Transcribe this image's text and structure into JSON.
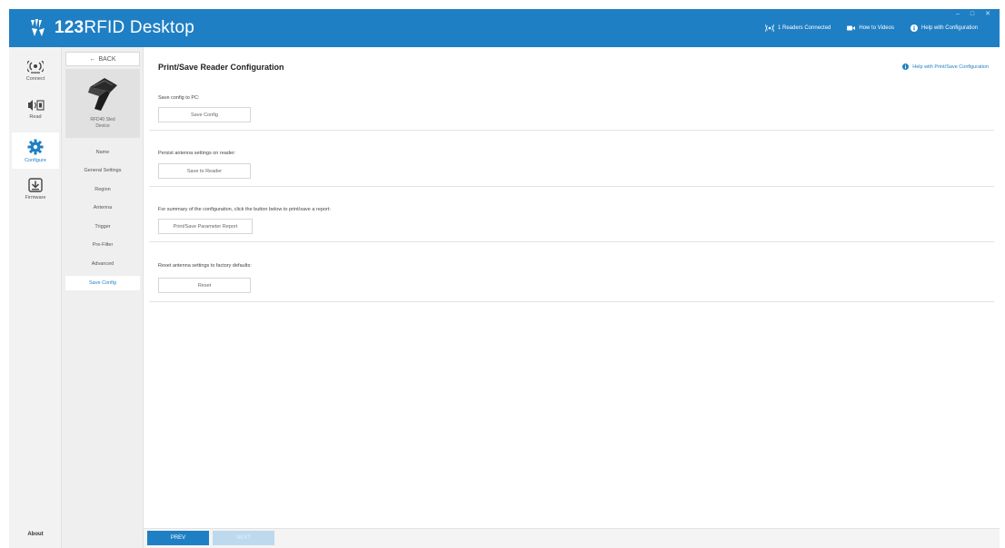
{
  "app": {
    "title_prefix": "123",
    "title_suffix": "RFID Desktop"
  },
  "titlebar": {
    "readers_connected": "1 Readers Connected",
    "how_to_videos": "How to Videos",
    "help_with_configuration": "Help with Configuration",
    "window_controls": [
      "–",
      "□",
      "✕"
    ]
  },
  "rail": {
    "items": [
      {
        "label": "Connect",
        "icon": "reader-signal-icon"
      },
      {
        "label": "Read",
        "icon": "read-tag-icon"
      },
      {
        "label": "Configure",
        "icon": "gear-icon"
      },
      {
        "label": "Firmware",
        "icon": "download-icon"
      }
    ],
    "about": "About"
  },
  "subnav": {
    "back": "BACK",
    "device_name_line1": "RFD40 Sled",
    "device_name_line2": "Device",
    "items": [
      "Name",
      "General Settings",
      "Region",
      "Antenna",
      "Trigger",
      "Pre-Filter",
      "Advanced",
      "Save Config"
    ],
    "active_index": 7
  },
  "main": {
    "title": "Print/Save Reader Configuration",
    "help_link": "Help with Print/Save Configuration",
    "sections": [
      {
        "label": "Save config to PC:",
        "button": "Save Config"
      },
      {
        "label": "Persist antenna settings on reader:",
        "button": "Save to Reader"
      },
      {
        "label": "For summary of the configuration, click the button below to print/save a report:",
        "button": "Print/Save Parameter Report"
      },
      {
        "label": "Reset antenna settings to factory defaults:",
        "button": "Reset"
      }
    ]
  },
  "footer": {
    "prev": "PREV",
    "next": "NEXT"
  },
  "colors": {
    "brand_blue": "#1f7fc4",
    "disabled_blue": "#bcd9ee"
  }
}
